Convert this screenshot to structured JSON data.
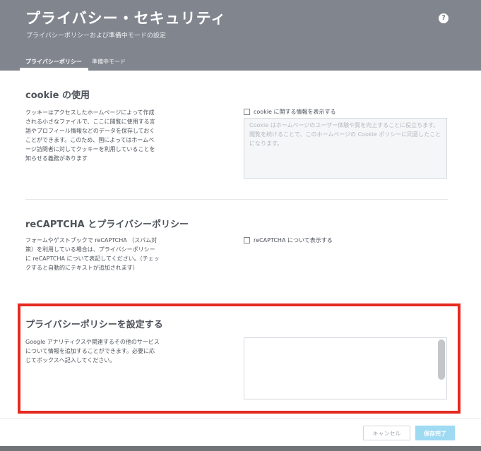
{
  "header": {
    "title": "プライバシー・セキュリティ",
    "subtitle": "プライバシーポリシーおよび準備中モードの設定",
    "help_label": "?",
    "background_color": "#81868e"
  },
  "tabs": [
    {
      "label": "プライバシーポリシー",
      "active": true
    },
    {
      "label": "準備中モード",
      "active": false
    }
  ],
  "sections": {
    "cookie": {
      "title": "cookie の使用",
      "description": "クッキーはアクセスしたホームページによって作成される小さなファイルで、ここに閲覧に使用する言語やプロフィール情報などのデータを保存しておくことができます。このため、国によってはホームページ訪問者に対してクッキーを利用していることを知らせる義務があります",
      "checkbox_label": "cookie に関する情報を表示する",
      "checkbox_checked": false,
      "textarea_text": "Cookie はホームページのユーザー体験や質を向上することに役立ちます。閲覧を続けることで、このホームページの Cookie ポリシーに同意したことになります。"
    },
    "recaptcha": {
      "title": "reCAPTCHA とプライバシーポリシー",
      "description": "フォームやゲストブックで reCAPTCHA （スパム対策）を利用している場合は、プライバシーポリシーに reCAPTCHA について表記してください。（チェックすると自動的にテキストが追加されます）",
      "checkbox_label": "reCAPTCHA について表示する",
      "checkbox_checked": false
    },
    "privacy_policy": {
      "title": "プライバシーポリシーを設定する",
      "description": "Google アナリティクスや関連するその他のサービスについて情報を追加することができます。必要に応じてボックスへ記入してください。",
      "textarea_value": ""
    }
  },
  "footer": {
    "cancel_label": "キャンセル",
    "save_label": "保存完了",
    "save_color": "#9fdaf3"
  },
  "highlight_color": "#e52a20"
}
